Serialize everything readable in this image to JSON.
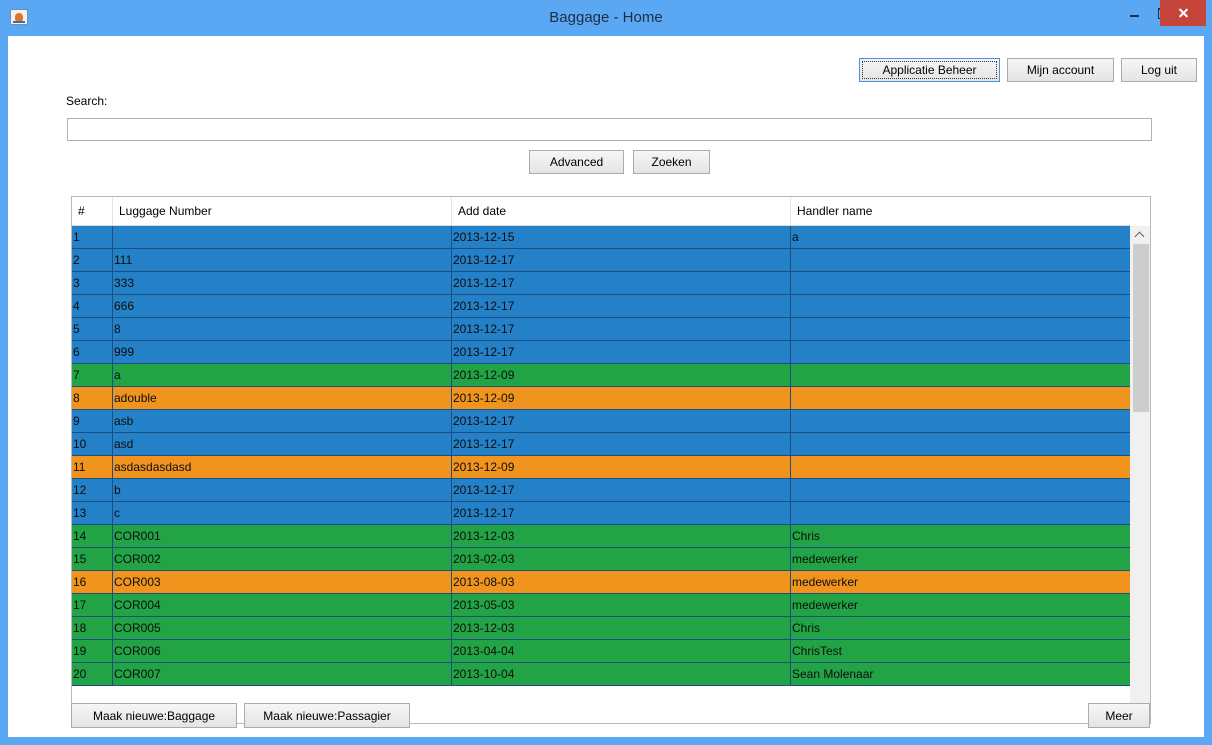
{
  "window": {
    "title": "Baggage - Home"
  },
  "header": {
    "app_beheer_label": "Applicatie Beheer",
    "account_label": "Mijn account",
    "logout_label": "Log uit"
  },
  "search": {
    "label": "Search:",
    "value": "",
    "advanced_label": "Advanced",
    "zoeken_label": "Zoeken"
  },
  "table": {
    "columns": [
      "#",
      "Luggage Number",
      "Add date",
      "Handler name"
    ],
    "rows": [
      {
        "num": "1",
        "luggage": "",
        "date": "2013-12-15",
        "handler": "a",
        "status": "blue"
      },
      {
        "num": "2",
        "luggage": "111",
        "date": "2013-12-17",
        "handler": "",
        "status": "blue"
      },
      {
        "num": "3",
        "luggage": "333",
        "date": "2013-12-17",
        "handler": "",
        "status": "blue"
      },
      {
        "num": "4",
        "luggage": "666",
        "date": "2013-12-17",
        "handler": "",
        "status": "blue"
      },
      {
        "num": "5",
        "luggage": "8",
        "date": "2013-12-17",
        "handler": "",
        "status": "blue"
      },
      {
        "num": "6",
        "luggage": "999",
        "date": "2013-12-17",
        "handler": "",
        "status": "blue"
      },
      {
        "num": "7",
        "luggage": "a",
        "date": "2013-12-09",
        "handler": "",
        "status": "green"
      },
      {
        "num": "8",
        "luggage": "adouble",
        "date": "2013-12-09",
        "handler": "",
        "status": "orange"
      },
      {
        "num": "9",
        "luggage": "asb",
        "date": "2013-12-17",
        "handler": "",
        "status": "blue"
      },
      {
        "num": "10",
        "luggage": "asd",
        "date": "2013-12-17",
        "handler": "",
        "status": "blue"
      },
      {
        "num": "11",
        "luggage": "asdasdasdasd",
        "date": "2013-12-09",
        "handler": "",
        "status": "orange"
      },
      {
        "num": "12",
        "luggage": "b",
        "date": "2013-12-17",
        "handler": "",
        "status": "blue"
      },
      {
        "num": "13",
        "luggage": "c",
        "date": "2013-12-17",
        "handler": "",
        "status": "blue"
      },
      {
        "num": "14",
        "luggage": "COR001",
        "date": "2013-12-03",
        "handler": "Chris",
        "status": "green"
      },
      {
        "num": "15",
        "luggage": "COR002",
        "date": "2013-02-03",
        "handler": "medewerker",
        "status": "green"
      },
      {
        "num": "16",
        "luggage": "COR003",
        "date": "2013-08-03",
        "handler": "medewerker",
        "status": "orange"
      },
      {
        "num": "17",
        "luggage": "COR004",
        "date": "2013-05-03",
        "handler": "medewerker",
        "status": "green"
      },
      {
        "num": "18",
        "luggage": "COR005",
        "date": "2013-12-03",
        "handler": "Chris",
        "status": "green"
      },
      {
        "num": "19",
        "luggage": "COR006",
        "date": "2013-04-04",
        "handler": "ChrisTest",
        "status": "green"
      },
      {
        "num": "20",
        "luggage": "COR007",
        "date": "2013-10-04",
        "handler": "Sean Molenaar",
        "status": "green"
      }
    ]
  },
  "footer": {
    "new_baggage_label": "Maak nieuwe:Baggage",
    "new_passenger_label": "Maak nieuwe:Passagier",
    "more_label": "Meer"
  },
  "colors": {
    "blue": "#2481c8",
    "green": "#22a446",
    "orange": "#f0941e",
    "titlebar": "#5aa8f4",
    "close": "#c7443a"
  },
  "icons": {
    "app": "java-app-icon",
    "minimize": "minimize-icon",
    "maximize": "maximize-icon",
    "close": "close-icon",
    "scroll_up": "chevron-up-icon",
    "scroll_down": "chevron-down-icon"
  }
}
